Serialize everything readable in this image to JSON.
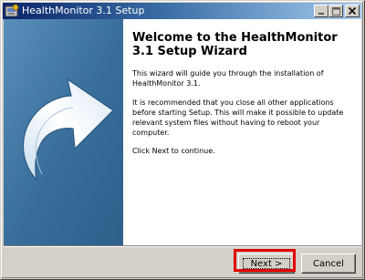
{
  "window": {
    "title": "HealthMonitor 3.1 Setup"
  },
  "content": {
    "welcome_heading": "Welcome to the HealthMonitor 3.1 Setup Wizard",
    "para1": "This wizard will guide you through the installation of HealthMonitor 3.1.",
    "para2": "It is recommended that you close all other applications before starting Setup. This will make it possible to update relevant system files without having to reboot your computer.",
    "para3": "Click Next to continue."
  },
  "buttons": {
    "next_label": "Next >",
    "cancel_label": "Cancel"
  },
  "colors": {
    "title_bar_start": "#0a246a",
    "left_panel": "#3d74a0",
    "highlight_box": "#e00000"
  }
}
